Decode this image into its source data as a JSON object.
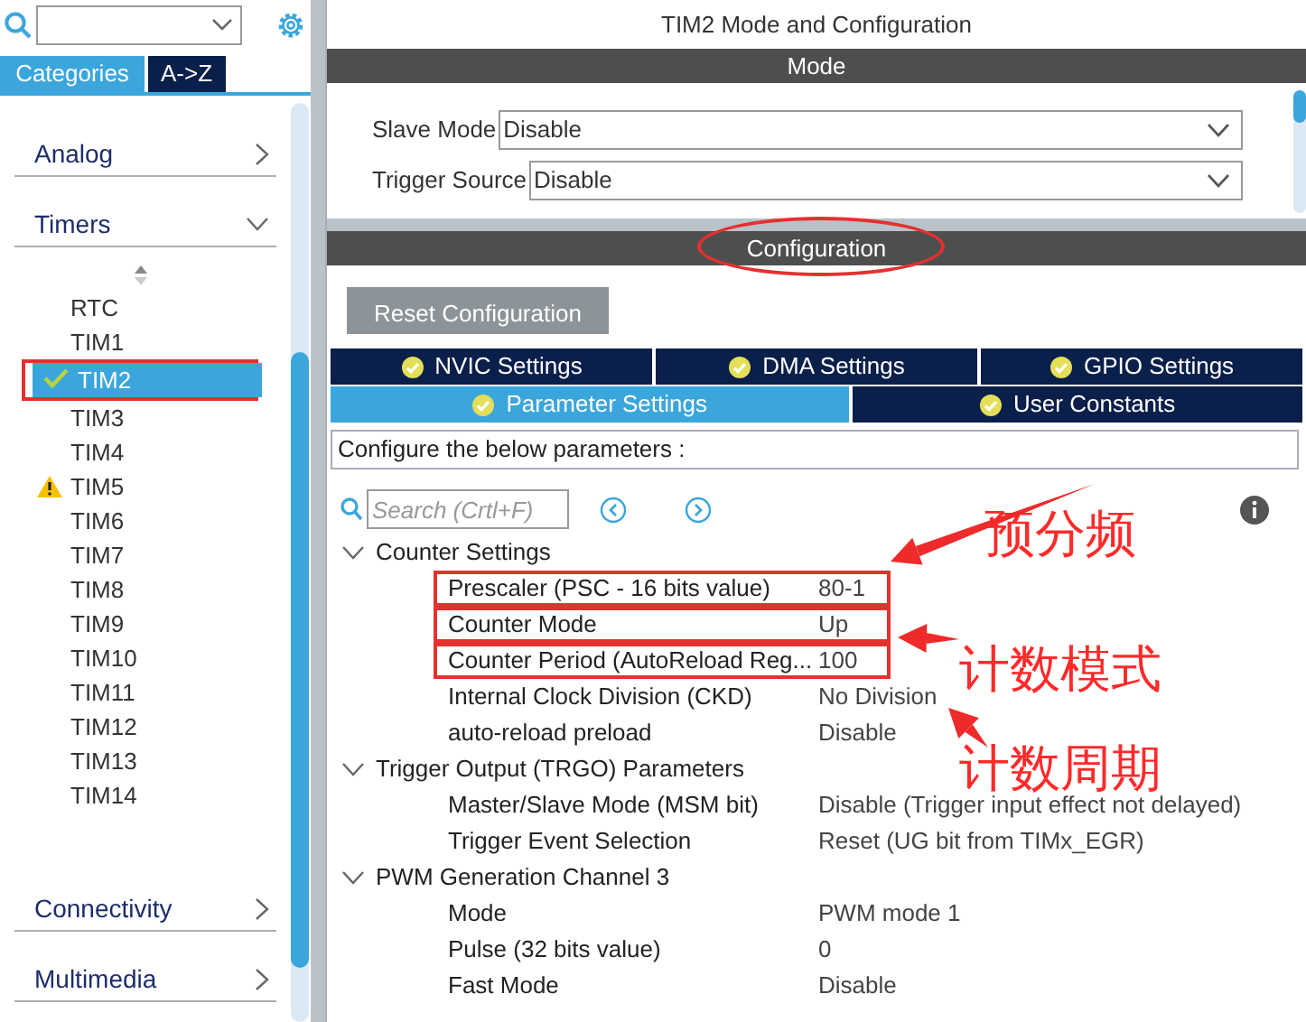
{
  "sidebar": {
    "tabs": [
      {
        "label": "Categories",
        "selected": true
      },
      {
        "label": "A->Z",
        "selected": false
      }
    ],
    "categories": [
      {
        "label": "Analog",
        "expanded": false
      },
      {
        "label": "Timers",
        "expanded": true,
        "children": [
          {
            "label": "RTC",
            "selected": false,
            "configured": false,
            "warning": false,
            "annotated": false
          },
          {
            "label": "TIM1",
            "selected": false,
            "configured": false,
            "warning": false,
            "annotated": false
          },
          {
            "label": "TIM2",
            "selected": true,
            "configured": true,
            "warning": false,
            "annotated": true
          },
          {
            "label": "TIM3",
            "selected": false,
            "configured": false,
            "warning": false,
            "annotated": false
          },
          {
            "label": "TIM4",
            "selected": false,
            "configured": false,
            "warning": false,
            "annotated": false
          },
          {
            "label": "TIM5",
            "selected": false,
            "configured": false,
            "warning": true,
            "annotated": false
          },
          {
            "label": "TIM6",
            "selected": false,
            "configured": false,
            "warning": false,
            "annotated": false
          },
          {
            "label": "TIM7",
            "selected": false,
            "configured": false,
            "warning": false,
            "annotated": false
          },
          {
            "label": "TIM8",
            "selected": false,
            "configured": false,
            "warning": false,
            "annotated": false
          },
          {
            "label": "TIM9",
            "selected": false,
            "configured": false,
            "warning": false,
            "annotated": false
          },
          {
            "label": "TIM10",
            "selected": false,
            "configured": false,
            "warning": false,
            "annotated": false
          },
          {
            "label": "TIM11",
            "selected": false,
            "configured": false,
            "warning": false,
            "annotated": false
          },
          {
            "label": "TIM12",
            "selected": false,
            "configured": false,
            "warning": false,
            "annotated": false
          },
          {
            "label": "TIM13",
            "selected": false,
            "configured": false,
            "warning": false,
            "annotated": false
          },
          {
            "label": "TIM14",
            "selected": false,
            "configured": false,
            "warning": false,
            "annotated": false
          }
        ]
      },
      {
        "label": "Connectivity",
        "expanded": false
      },
      {
        "label": "Multimedia",
        "expanded": false
      }
    ]
  },
  "panel": {
    "title": "TIM2 Mode and Configuration",
    "mode": {
      "header": "Mode",
      "fields": [
        {
          "label": "Slave Mode",
          "value": "Disable"
        },
        {
          "label": "Trigger Source",
          "value": "Disable"
        }
      ]
    },
    "configuration": {
      "header": "Configuration",
      "circled": true,
      "reset_button": "Reset Configuration",
      "tabs": [
        {
          "label": "NVIC Settings",
          "selected": false
        },
        {
          "label": "DMA Settings",
          "selected": false
        },
        {
          "label": "GPIO Settings",
          "selected": false
        },
        {
          "label": "Parameter Settings",
          "selected": true
        },
        {
          "label": "User Constants",
          "selected": false
        }
      ],
      "hint": "Configure the below parameters :",
      "search": {
        "placeholder": "Search (Crtl+F)"
      },
      "groups": [
        {
          "label": "Counter Settings",
          "expanded": true,
          "children": [
            {
              "label": "Prescaler (PSC - 16 bits value)",
              "value": "80-1",
              "annotated": true
            },
            {
              "label": "Counter Mode",
              "value": "Up",
              "annotated": true
            },
            {
              "label": "Counter Period (AutoReload Reg...",
              "value": "100",
              "annotated": true
            },
            {
              "label": "Internal Clock Division (CKD)",
              "value": "No Division",
              "annotated": false
            },
            {
              "label": "auto-reload preload",
              "value": "Disable",
              "annotated": false
            }
          ]
        },
        {
          "label": "Trigger Output (TRGO) Parameters",
          "expanded": true,
          "children": [
            {
              "label": "Master/Slave Mode (MSM bit)",
              "value": "Disable (Trigger input effect not delayed)",
              "annotated": false
            },
            {
              "label": "Trigger Event Selection",
              "value": "Reset (UG bit from TIMx_EGR)",
              "annotated": false
            }
          ]
        },
        {
          "label": "PWM Generation Channel 3",
          "expanded": true,
          "children": [
            {
              "label": "Mode",
              "value": "PWM mode 1",
              "annotated": false
            },
            {
              "label": "Pulse (32 bits value)",
              "value": "0",
              "annotated": false
            },
            {
              "label": "Fast Mode",
              "value": "Disable",
              "annotated": false
            }
          ]
        }
      ]
    }
  },
  "annotations": [
    {
      "text": "预分频"
    },
    {
      "text": "计数模式"
    },
    {
      "text": "计数周期"
    }
  ]
}
